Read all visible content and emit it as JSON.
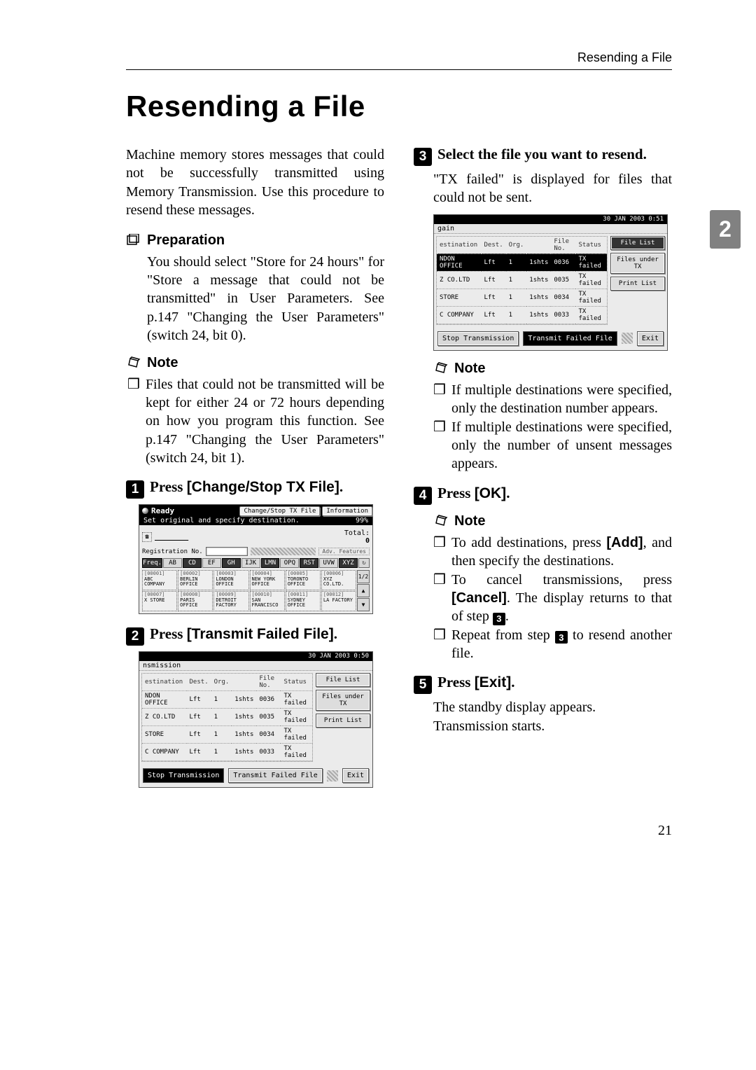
{
  "header": {
    "running": "Resending a File"
  },
  "title": "Resending a File",
  "side_tab": "2",
  "page_number": "21",
  "left": {
    "intro": "Machine memory stores messages that could not be successfully transmitted using Memory Transmission. Use this procedure to resend these messages.",
    "preparation": {
      "heading": "Preparation",
      "body": "You should select \"Store for 24 hours\" for \"Store a message that could not be transmitted\" in User Parameters. See p.147 \"Changing the User Parameters\" (switch 24, bit 0)."
    },
    "note": {
      "heading": "Note",
      "bullet": "❒",
      "body": "Files that could not be transmitted will be kept for either 24 or 72 hours depending on how you program this function. See p.147 \"Changing the User Parameters\" (switch 24, bit 1)."
    },
    "step1": {
      "num": "1",
      "pre": "Press ",
      "btn": "[Change/Stop TX File]",
      "post": "."
    },
    "step2": {
      "num": "2",
      "pre": "Press ",
      "btn": "[Transmit Failed File]",
      "post": "."
    },
    "ss_a": {
      "ready": "Ready",
      "sub": "Set original and specify destination.",
      "change_btn": "Change/Stop TX File",
      "info_btn": "Information",
      "pct": "99%",
      "total_lbl": "Total:",
      "total_val": "0",
      "reg_lbl": "Registration No.",
      "adv": "Adv. Features",
      "letters": [
        "Freq.",
        "AB",
        "CD",
        "EF",
        "GH",
        "IJK",
        "LMN",
        "OPQ",
        "RST",
        "UVW",
        "XYZ"
      ],
      "page": "1/2",
      "dest_codes": [
        "[00001]",
        "[00002]",
        "[00003]",
        "[00004]",
        "[00005]",
        "[00006]",
        "[00007]",
        "[00008]",
        "[00009]",
        "[00010]",
        "[00011]",
        "[00012]"
      ],
      "dest_names": [
        "ABC COMPANY",
        "BERLIN OFFICE",
        "LONDON OFFICE",
        "NEW YORK OFFICE",
        "TORONTO OFFICE",
        "XYZ CO.LTD.",
        "X STORE",
        "PARIS OFFICE",
        "DETROIT FACTORY",
        "SAN FRANCISCO",
        "SYDNEY OFFICE",
        "LA FACTORY"
      ]
    },
    "ss_b": {
      "clock": "30 JAN  2003  0:50",
      "mission": "nsmission",
      "th": [
        "estination",
        "Dest.",
        "Org.",
        "File No.",
        "Status"
      ],
      "rows": [
        [
          "NDON OFFICE",
          "Lft",
          "1",
          "1shts",
          "0036",
          "TX failed"
        ],
        [
          "Z CO.LTD",
          "Lft",
          "1",
          "1shts",
          "0035",
          "TX failed"
        ],
        [
          "STORE",
          "Lft",
          "1",
          "1shts",
          "0034",
          "TX failed"
        ],
        [
          "C COMPANY",
          "Lft",
          "1",
          "1shts",
          "0033",
          "TX failed"
        ]
      ],
      "side": [
        "File List",
        "Files under TX",
        "Print List"
      ],
      "bottom": [
        "Stop Transmission",
        "Transmit Failed File",
        "Exit"
      ]
    }
  },
  "right": {
    "step3": {
      "num": "3",
      "text": "Select the file you want to resend.",
      "sub": "\"TX failed\" is displayed for files that could not be sent."
    },
    "ss_c": {
      "clock": "30 JAN  2003  0:51",
      "again": "gain",
      "th": [
        "estination",
        "Dest.",
        "Org.",
        "File No.",
        "Status"
      ],
      "rows": [
        [
          "NDON OFFICE",
          "Lft",
          "1",
          "1shts",
          "0036",
          "TX failed"
        ],
        [
          "Z CO.LTD",
          "Lft",
          "1",
          "1shts",
          "0035",
          "TX failed"
        ],
        [
          "STORE",
          "Lft",
          "1",
          "1shts",
          "0034",
          "TX failed"
        ],
        [
          "C COMPANY",
          "Lft",
          "1",
          "1shts",
          "0033",
          "TX failed"
        ]
      ],
      "side": [
        "File List",
        "Files under TX",
        "Print List"
      ],
      "bottom": [
        "Stop Transmission",
        "Transmit Failed File",
        "Exit"
      ]
    },
    "note1": {
      "heading": "Note",
      "bullet": "❒",
      "b1": "If multiple destinations were specified, only the destination number appears.",
      "b2": "If multiple destinations were specified, only the number of unsent messages appears."
    },
    "step4": {
      "num": "4",
      "pre": "Press ",
      "btn": "[OK]",
      "post": "."
    },
    "note2": {
      "heading": "Note",
      "bullet": "❒",
      "b1a": "To add destinations, press ",
      "b1btn": "[Add]",
      "b1b": ", and then specify the destinations.",
      "b2a": "To cancel transmissions, press ",
      "b2btn": "[Cancel]",
      "b2b": ". The display returns to that of step ",
      "b2ref": "3",
      "b2c": ".",
      "b3a": "Repeat from step ",
      "b3ref": "3",
      "b3b": " to resend another file."
    },
    "step5": {
      "num": "5",
      "pre": "Press ",
      "btn": "[Exit]",
      "post": "."
    },
    "tail1": "The standby display appears.",
    "tail2": "Transmission starts."
  }
}
